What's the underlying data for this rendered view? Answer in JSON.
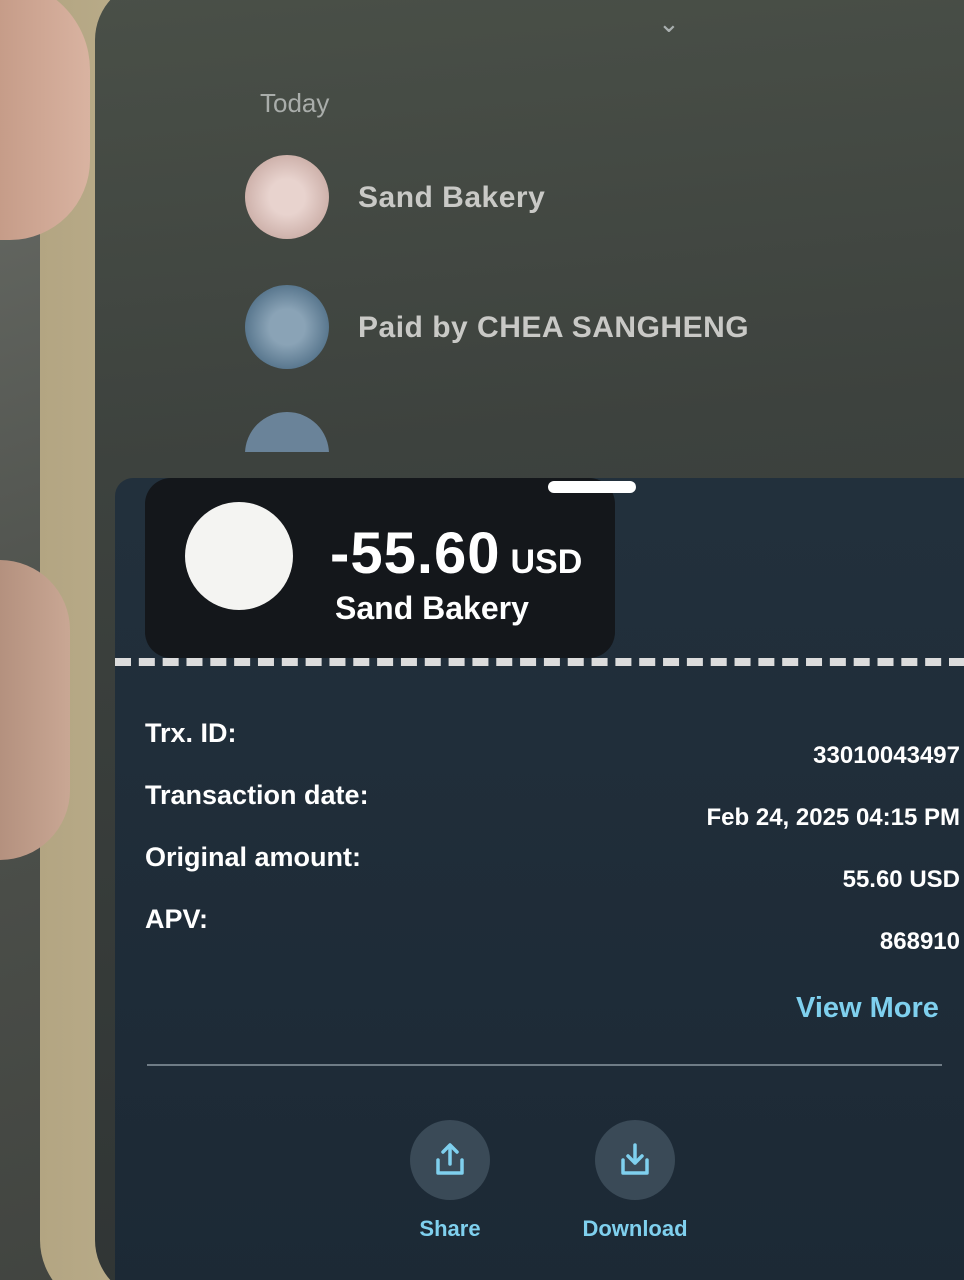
{
  "list": {
    "section_title": "Today",
    "items": [
      {
        "label": "Sand Bakery"
      },
      {
        "label": "Paid by CHEA SANGHENG"
      }
    ]
  },
  "transaction": {
    "amount": "-55.60",
    "currency": "USD",
    "merchant": "Sand Bakery",
    "details": [
      {
        "key": "Trx. ID:",
        "value": "33010043497"
      },
      {
        "key": "Transaction date:",
        "value": "Feb 24, 2025 04:15 PM"
      },
      {
        "key": "Original amount:",
        "value": "55.60 USD"
      },
      {
        "key": "APV:",
        "value": "868910"
      }
    ],
    "view_more": "View More"
  },
  "actions": {
    "share": "Share",
    "download": "Download"
  },
  "colors": {
    "accent": "#7fd0ee",
    "sheet_bg": "#1c2935",
    "header_bg": "#14171b"
  },
  "icons": {
    "collapse": "chevron-down-icon",
    "share": "share-icon",
    "download": "download-icon"
  }
}
